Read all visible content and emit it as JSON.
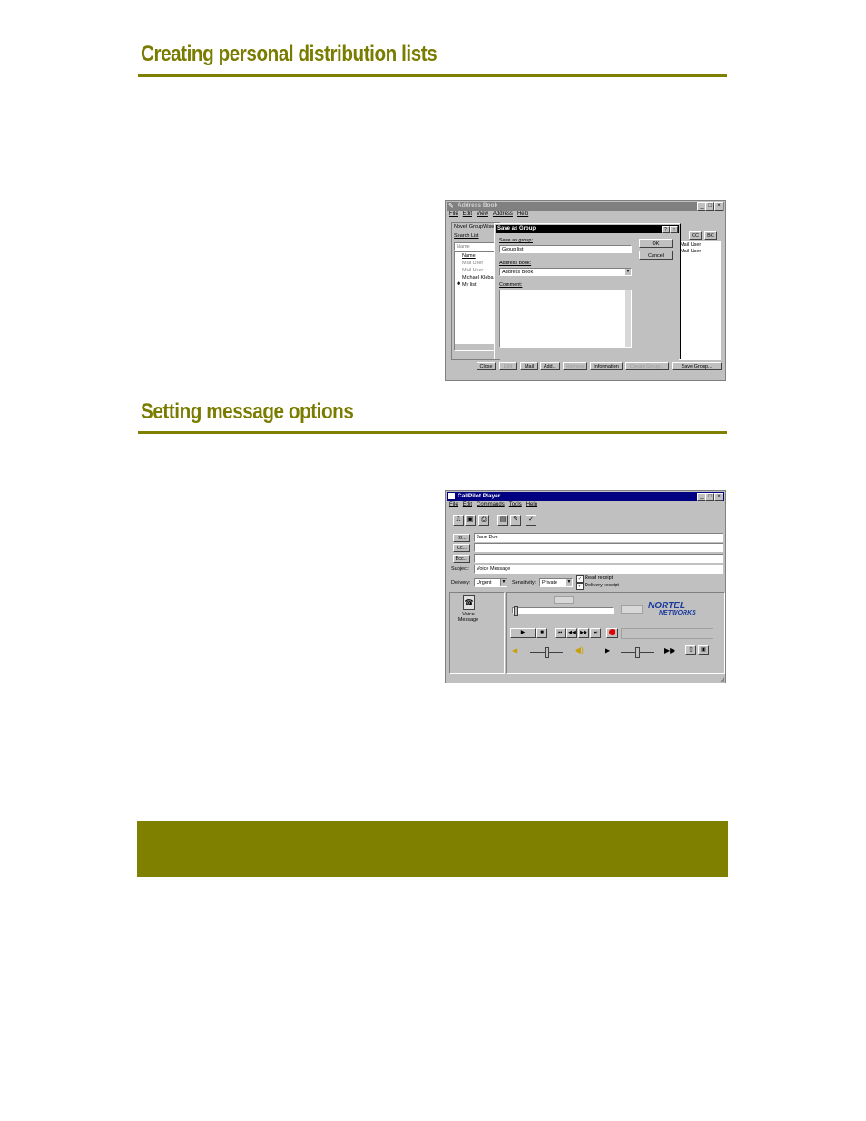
{
  "sections": {
    "heading1": "Creating personal distribution lists",
    "heading2": "Setting message options"
  },
  "address_book": {
    "title": "Address Book",
    "menu": [
      "File",
      "Edit",
      "View",
      "Address",
      "Help"
    ],
    "tab_label": "Novell GroupWise",
    "search_list_label": "Search List",
    "name_placeholder": "Name",
    "name_column": "Name",
    "list_items": [
      "Mail User",
      "Mail User",
      "Michael Kleba",
      "My list"
    ],
    "to_buttons": [
      "CC",
      "BC"
    ],
    "recipients": [
      "Mail User",
      "Mail User"
    ],
    "bottom_buttons": [
      "Close",
      "Edit",
      "Mail",
      "Add...",
      "Remove",
      "Information",
      "Create Group...",
      "Save Group..."
    ],
    "dialog": {
      "title": "Save as Group",
      "save_as_label": "Save as group:",
      "save_as_value": "Group list",
      "address_book_label": "Address book:",
      "address_book_value": "Address Book",
      "comment_label": "Comment:",
      "ok_label": "OK",
      "cancel_label": "Cancel"
    }
  },
  "callpilot": {
    "title": "CallPilot Player",
    "menu": [
      "File",
      "Edit",
      "Commands",
      "Tools",
      "Help"
    ],
    "to_label": "To...",
    "cc_label": "Cc...",
    "bcc_label": "Bcc...",
    "to_value": "Jane Doe",
    "subject_label": "Subject:",
    "subject_value": "Voice Message",
    "delivery_label": "Delivery:",
    "delivery_value": "Urgent",
    "sensitivity_label": "Sensitivity:",
    "sensitivity_value": "Private",
    "read_receipt_label": "Read receipt",
    "delivery_receipt_label": "Delivery receipt",
    "read_receipt_checked": true,
    "delivery_receipt_checked": true,
    "attachment_label": "Voice Message",
    "logo_line1": "NORTEL",
    "logo_line2": "NETWORKS",
    "logo_color": "#1a3a9c",
    "title_bar_color": "#000080"
  },
  "colors": {
    "heading": "#7a7c00",
    "rule": "#7f7f00",
    "band": "#7f7f00"
  }
}
